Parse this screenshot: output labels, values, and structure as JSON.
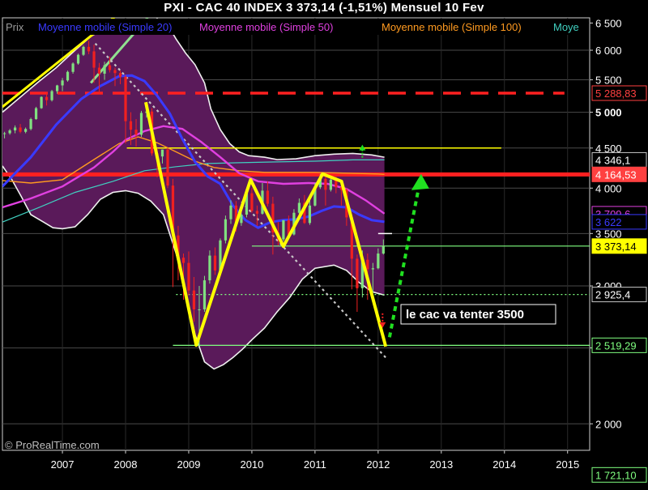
{
  "chart_data": {
    "type": "line",
    "title": "PXI - CAC 40 INDEX    3 373,14 (-1,51%)    Mensuel  10 Fev",
    "legend": [
      {
        "label": "Prix",
        "color": "#9a9a9a"
      },
      {
        "label": "Moyenne mobile (Simple 20)",
        "color": "#3a3aff"
      },
      {
        "label": "Moyenne mobile (Simple 50)",
        "color": "#e040e0"
      },
      {
        "label": "Moyenne mobile (Simple 100)",
        "color": "#ff9a20"
      },
      {
        "label": "Moye",
        "color": "#40d0c0"
      }
    ],
    "x_ticks": [
      "2007",
      "2008",
      "2009",
      "2010",
      "2011",
      "2012",
      "2013",
      "2014",
      "2015"
    ],
    "y_ticks": [
      "6 500",
      "6 000",
      "5 500",
      "5 000",
      "4 500",
      "4 000",
      "3 500",
      "3 000",
      "2 500",
      "2 000"
    ],
    "ylim": [
      1850,
      6600
    ],
    "xlim": [
      2006.05,
      2015.35
    ],
    "price_labels": [
      {
        "value": 5288.83,
        "text": "5 288,83",
        "bg": "#000000",
        "fg": "#ff4040",
        "border": "#ff4040"
      },
      {
        "value": 4346.1,
        "text": "4 346,1",
        "bg": "#000000",
        "fg": "#ffffff",
        "border": "#c8c8c8"
      },
      {
        "value": 4164.53,
        "text": "4 164,53",
        "bg": "#ff4040",
        "fg": "#ffffff",
        "border": "#ff4040"
      },
      {
        "value": 3709.6,
        "text": "3 709,6",
        "bg": "#000000",
        "fg": "#e040e0",
        "border": "#e040e0"
      },
      {
        "value": 3622,
        "text": "3 622",
        "bg": "#000000",
        "fg": "#3a3aff",
        "border": "#3a3aff"
      },
      {
        "value": 3373.14,
        "text": "3 373,14",
        "bg": "#ffff00",
        "fg": "#000000",
        "border": "#ffff00"
      },
      {
        "value": 2925.4,
        "text": "2 925,4",
        "bg": "#000000",
        "fg": "#ffffff",
        "border": "#c8c8c8"
      },
      {
        "value": 2519.29,
        "text": "2 519,29",
        "bg": "#000000",
        "fg": "#80ff80",
        "border": "#80ff80"
      },
      {
        "value": 1721.1,
        "text": "1 721,10",
        "bg": "#000000",
        "fg": "#80ff80",
        "border": "#80ff80"
      }
    ],
    "annotation": "le cac va tenter 3500",
    "watermark": "© ProRealTime.com",
    "colors": {
      "band": "#5a1a5a",
      "up_candle": "#80e080",
      "down_candle": "#f02020",
      "ma20": "#3a3aff",
      "ma50": "#e040e0",
      "ma100": "#ff9a20",
      "ma200": "#40d0c0",
      "zigzag": "#ffff00",
      "resistance": "#ff2020",
      "support": "#80ff80",
      "arrow": "#20e020"
    },
    "candles": [
      [
        2006.0,
        4715,
        4740,
        4670,
        4690
      ],
      [
        2006.083,
        4690,
        4720,
        4630,
        4700
      ],
      [
        2006.167,
        4700,
        4760,
        4680,
        4740
      ],
      [
        2006.25,
        4740,
        4810,
        4700,
        4780
      ],
      [
        2006.333,
        4780,
        4830,
        4700,
        4720
      ],
      [
        2006.417,
        4720,
        4780,
        4700,
        4760
      ],
      [
        2006.5,
        4760,
        4920,
        4740,
        4900
      ],
      [
        2006.583,
        4900,
        5080,
        4890,
        5060
      ],
      [
        2006.667,
        5060,
        5240,
        5050,
        5230
      ],
      [
        2006.75,
        5230,
        5300,
        5100,
        5180
      ],
      [
        2006.833,
        5180,
        5340,
        5160,
        5320
      ],
      [
        2006.917,
        5320,
        5420,
        5280,
        5410
      ],
      [
        2007.0,
        5410,
        5530,
        5320,
        5490
      ],
      [
        2007.083,
        5490,
        5650,
        5470,
        5630
      ],
      [
        2007.167,
        5630,
        5790,
        5600,
        5770
      ],
      [
        2007.25,
        5770,
        5940,
        5750,
        5920
      ],
      [
        2007.333,
        5920,
        6080,
        5900,
        6060
      ],
      [
        2007.417,
        6060,
        6170,
        5930,
        5980
      ],
      [
        2007.5,
        5980,
        6100,
        5450,
        5700
      ],
      [
        2007.583,
        5700,
        5780,
        5270,
        5600
      ],
      [
        2007.667,
        5600,
        5800,
        5500,
        5740
      ],
      [
        2007.75,
        5740,
        5890,
        5620,
        5660
      ],
      [
        2007.833,
        5660,
        5700,
        5400,
        5610
      ],
      [
        2007.917,
        5610,
        5650,
        5430,
        5550
      ],
      [
        2008.0,
        5550,
        5580,
        4560,
        4870
      ],
      [
        2008.083,
        4870,
        5000,
        4540,
        4750
      ],
      [
        2008.167,
        4750,
        4900,
        4520,
        4680
      ],
      [
        2008.25,
        4680,
        5020,
        4650,
        4990
      ],
      [
        2008.333,
        4990,
        5150,
        4920,
        5010
      ],
      [
        2008.417,
        5010,
        5060,
        4400,
        4430
      ],
      [
        2008.5,
        4430,
        4500,
        4130,
        4390
      ],
      [
        2008.583,
        4390,
        4480,
        4300,
        4480
      ],
      [
        2008.667,
        4480,
        4500,
        4000,
        4030
      ],
      [
        2008.75,
        4030,
        4110,
        2990,
        3480
      ],
      [
        2008.833,
        3480,
        3580,
        3050,
        3260
      ],
      [
        2008.917,
        3260,
        3300,
        2880,
        3210
      ],
      [
        2009.0,
        3210,
        3320,
        2920,
        2960
      ],
      [
        2009.083,
        2960,
        3080,
        2700,
        2800
      ],
      [
        2009.167,
        2800,
        3000,
        2520,
        2800
      ],
      [
        2009.25,
        2800,
        3090,
        2780,
        3050
      ],
      [
        2009.333,
        3050,
        3330,
        3020,
        3280
      ],
      [
        2009.417,
        3280,
        3360,
        3100,
        3140
      ],
      [
        2009.5,
        3140,
        3450,
        3100,
        3430
      ],
      [
        2009.583,
        3430,
        3690,
        3400,
        3650
      ],
      [
        2009.667,
        3650,
        3860,
        3600,
        3800
      ],
      [
        2009.75,
        3800,
        3850,
        3520,
        3610
      ],
      [
        2009.833,
        3610,
        3760,
        3580,
        3700
      ],
      [
        2009.917,
        3700,
        3950,
        3670,
        3940
      ],
      [
        2010.0,
        3940,
        4000,
        3720,
        3740
      ],
      [
        2010.083,
        3740,
        3800,
        3580,
        3710
      ],
      [
        2010.167,
        3710,
        4060,
        3700,
        3970
      ],
      [
        2010.25,
        3970,
        4080,
        3790,
        3820
      ],
      [
        2010.333,
        3820,
        3900,
        3290,
        3510
      ],
      [
        2010.417,
        3510,
        3620,
        3380,
        3440
      ],
      [
        2010.5,
        3440,
        3640,
        3420,
        3640
      ],
      [
        2010.583,
        3640,
        3690,
        3460,
        3490
      ],
      [
        2010.667,
        3490,
        3760,
        3480,
        3720
      ],
      [
        2010.75,
        3720,
        3880,
        3700,
        3830
      ],
      [
        2010.833,
        3830,
        3920,
        3600,
        3610
      ],
      [
        2010.917,
        3610,
        3910,
        3590,
        3800
      ],
      [
        2011.0,
        3800,
        4060,
        3790,
        4010
      ],
      [
        2011.083,
        4010,
        4170,
        3990,
        4110
      ],
      [
        2011.167,
        4110,
        4160,
        3800,
        3980
      ],
      [
        2011.25,
        3980,
        4110,
        3960,
        4100
      ],
      [
        2011.333,
        4100,
        4150,
        3940,
        4010
      ],
      [
        2011.417,
        4010,
        4090,
        3800,
        3980
      ],
      [
        2011.5,
        3980,
        4000,
        3580,
        3670
      ],
      [
        2011.583,
        3670,
        3700,
        2970,
        3250
      ],
      [
        2011.667,
        3250,
        3290,
        2780,
        2980
      ],
      [
        2011.75,
        2980,
        3330,
        2900,
        3240
      ],
      [
        2011.833,
        3240,
        3300,
        2880,
        3150
      ],
      [
        2011.917,
        3150,
        3210,
        2940,
        3160
      ],
      [
        2012.0,
        3160,
        3350,
        3150,
        3300
      ],
      [
        2012.083,
        3300,
        3440,
        3290,
        3373
      ]
    ],
    "bb_upper": [
      [
        2006.05,
        5000
      ],
      [
        2006.3,
        5200
      ],
      [
        2006.6,
        5450
      ],
      [
        2006.9,
        5700
      ],
      [
        2007.2,
        6000
      ],
      [
        2007.45,
        6250
      ],
      [
        2007.65,
        6380
      ],
      [
        2007.9,
        6400
      ],
      [
        2008.1,
        6420
      ],
      [
        2008.3,
        6480
      ],
      [
        2008.5,
        6580
      ],
      [
        2008.65,
        6500
      ],
      [
        2008.8,
        6200
      ],
      [
        2008.95,
        5950
      ],
      [
        2009.1,
        5750
      ],
      [
        2009.25,
        5450
      ],
      [
        2009.35,
        5050
      ],
      [
        2009.5,
        4750
      ],
      [
        2009.65,
        4560
      ],
      [
        2009.8,
        4450
      ],
      [
        2009.95,
        4400
      ],
      [
        2010.2,
        4380
      ],
      [
        2010.4,
        4350
      ],
      [
        2010.7,
        4360
      ],
      [
        2011.0,
        4400
      ],
      [
        2011.3,
        4420
      ],
      [
        2011.6,
        4430
      ],
      [
        2011.9,
        4410
      ],
      [
        2012.1,
        4380
      ]
    ],
    "bb_lower": [
      [
        2006.05,
        4270
      ],
      [
        2006.2,
        4100
      ],
      [
        2006.35,
        3900
      ],
      [
        2006.5,
        3700
      ],
      [
        2006.7,
        3620
      ],
      [
        2006.85,
        3560
      ],
      [
        2007.0,
        3550
      ],
      [
        2007.2,
        3570
      ],
      [
        2007.4,
        3700
      ],
      [
        2007.6,
        3870
      ],
      [
        2007.8,
        3950
      ],
      [
        2008.0,
        3970
      ],
      [
        2008.2,
        3940
      ],
      [
        2008.4,
        3850
      ],
      [
        2008.6,
        3700
      ],
      [
        2008.8,
        3300
      ],
      [
        2008.95,
        2950
      ],
      [
        2009.1,
        2600
      ],
      [
        2009.25,
        2400
      ],
      [
        2009.4,
        2350
      ],
      [
        2009.55,
        2380
      ],
      [
        2009.7,
        2430
      ],
      [
        2009.85,
        2490
      ],
      [
        2010.0,
        2560
      ],
      [
        2010.2,
        2650
      ],
      [
        2010.4,
        2780
      ],
      [
        2010.6,
        2900
      ],
      [
        2010.8,
        3060
      ],
      [
        2011.0,
        3160
      ],
      [
        2011.3,
        3190
      ],
      [
        2011.5,
        3140
      ],
      [
        2011.7,
        3030
      ],
      [
        2011.9,
        2950
      ],
      [
        2012.1,
        2920
      ]
    ],
    "ma20": [
      [
        2006.05,
        4020
      ],
      [
        2006.5,
        4380
      ],
      [
        2006.9,
        4820
      ],
      [
        2007.3,
        5200
      ],
      [
        2007.6,
        5400
      ],
      [
        2007.9,
        5560
      ],
      [
        2008.1,
        5570
      ],
      [
        2008.3,
        5480
      ],
      [
        2008.5,
        5250
      ],
      [
        2008.7,
        4980
      ],
      [
        2008.9,
        4620
      ],
      [
        2009.1,
        4320
      ],
      [
        2009.3,
        4140
      ],
      [
        2009.5,
        4050
      ],
      [
        2009.7,
        3800
      ],
      [
        2009.9,
        3640
      ],
      [
        2010.1,
        3560
      ],
      [
        2010.3,
        3620
      ],
      [
        2010.5,
        3640
      ],
      [
        2010.7,
        3650
      ],
      [
        2010.9,
        3680
      ],
      [
        2011.1,
        3740
      ],
      [
        2011.3,
        3790
      ],
      [
        2011.5,
        3780
      ],
      [
        2011.7,
        3700
      ],
      [
        2011.9,
        3640
      ],
      [
        2012.1,
        3622
      ]
    ],
    "ma50": [
      [
        2006.05,
        3780
      ],
      [
        2006.5,
        3880
      ],
      [
        2007.0,
        4020
      ],
      [
        2007.5,
        4250
      ],
      [
        2007.8,
        4450
      ],
      [
        2008.0,
        4610
      ],
      [
        2008.3,
        4730
      ],
      [
        2008.6,
        4800
      ],
      [
        2008.9,
        4760
      ],
      [
        2009.2,
        4580
      ],
      [
        2009.5,
        4380
      ],
      [
        2009.8,
        4180
      ],
      [
        2010.1,
        4080
      ],
      [
        2010.5,
        4050
      ],
      [
        2010.9,
        4060
      ],
      [
        2011.2,
        4050
      ],
      [
        2011.5,
        3990
      ],
      [
        2011.8,
        3860
      ],
      [
        2012.1,
        3710
      ]
    ],
    "ma100": [
      [
        2006.05,
        4090
      ],
      [
        2006.5,
        4060
      ],
      [
        2007.0,
        4100
      ],
      [
        2007.5,
        4350
      ],
      [
        2007.9,
        4560
      ],
      [
        2008.2,
        4650
      ],
      [
        2008.5,
        4570
      ],
      [
        2008.8,
        4450
      ],
      [
        2009.1,
        4330
      ],
      [
        2009.4,
        4250
      ],
      [
        2009.8,
        4210
      ],
      [
        2010.2,
        4190
      ],
      [
        2010.6,
        4190
      ],
      [
        2011.0,
        4190
      ],
      [
        2011.5,
        4180
      ],
      [
        2012.0,
        4170
      ],
      [
        2012.1,
        4165
      ]
    ],
    "ma200": [
      [
        2006.05,
        3620
      ],
      [
        2006.6,
        3770
      ],
      [
        2007.2,
        3950
      ],
      [
        2007.8,
        4080
      ],
      [
        2008.3,
        4210
      ],
      [
        2008.8,
        4260
      ],
      [
        2009.3,
        4300
      ],
      [
        2009.8,
        4310
      ],
      [
        2010.4,
        4320
      ],
      [
        2011.0,
        4330
      ],
      [
        2011.6,
        4346
      ],
      [
        2012.1,
        4346
      ]
    ],
    "zigzag": [
      [
        2008.32,
        5150
      ],
      [
        2009.12,
        2520
      ],
      [
        2009.98,
        4100
      ],
      [
        2010.5,
        3370
      ],
      [
        2011.12,
        4170
      ],
      [
        2011.42,
        4080
      ],
      [
        2012.12,
        2510
      ]
    ],
    "projection": {
      "from": [
        2012.18,
        2580
      ],
      "to": [
        2012.68,
        4150
      ]
    },
    "uptrend_upper": [
      [
        2006.05,
        5080
      ],
      [
        2007.85,
        6640
      ]
    ],
    "uptrend_lower": [
      [
        2007.45,
        5450
      ],
      [
        2008.35,
        6600
      ]
    ],
    "down_trend": [
      [
        2007.52,
        6120
      ],
      [
        2012.12,
        2430
      ]
    ],
    "resistance_dashed": {
      "value": 5288.83,
      "from": 2006.05,
      "to": 2014.95
    },
    "resistance_level": {
      "value": 4164.53,
      "from": 2006.05,
      "to": 2015.35
    },
    "yellow_level": {
      "value": 4500,
      "from": 2008.02,
      "to": 2013.95
    },
    "green_levels": [
      {
        "value": 3373.14,
        "from": 2010.0,
        "to": 2015.35,
        "dotted": false
      },
      {
        "value": 2925.4,
        "from": 2008.8,
        "to": 2015.35,
        "dotted": true
      },
      {
        "value": 2519.29,
        "from": 2008.75,
        "to": 2015.35,
        "dotted": false
      },
      {
        "value": 1721.1,
        "from": 2006.05,
        "to": 2015.35,
        "dotted": true
      }
    ],
    "white_marks": [
      {
        "value": 3500,
        "from": 2012.0,
        "to": 2012.22
      }
    ],
    "up_markers": [
      {
        "x": 2011.75,
        "y": 4480
      }
    ],
    "down_markers": [
      {
        "x": 2012.07,
        "y": 2690
      }
    ]
  }
}
